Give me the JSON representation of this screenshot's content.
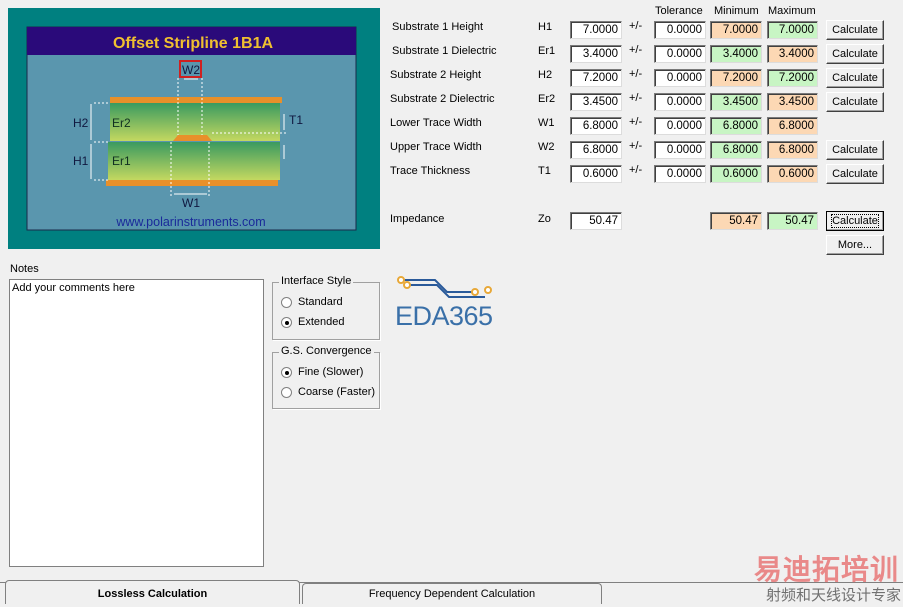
{
  "diagram": {
    "title": "Offset Stripline 1B1A",
    "url": "www.polarinstruments.com",
    "labels": {
      "w2": "W2",
      "w1": "W1",
      "h1": "H1",
      "h2": "H2",
      "er1": "Er1",
      "er2": "Er2",
      "t1": "T1"
    }
  },
  "headers": {
    "tolerance": "Tolerance",
    "minimum": "Minimum",
    "maximum": "Maximum"
  },
  "pm": "+/-",
  "calc_label": "Calculate",
  "rows": [
    {
      "label": "Substrate 1 Height",
      "sym": "H1",
      "value": "7.0000",
      "tol": "0.0000",
      "min": "7.0000",
      "max": "7.0000",
      "calc": true
    },
    {
      "label": "Substrate 1 Dielectric",
      "sym": "Er1",
      "value": "3.4000",
      "tol": "0.0000",
      "min": "3.4000",
      "max": "3.4000",
      "calc": true
    },
    {
      "label": "Substrate 2 Height",
      "sym": "H2",
      "value": "7.2000",
      "tol": "0.0000",
      "min": "7.2000",
      "max": "7.2000",
      "calc": true
    },
    {
      "label": "Substrate 2 Dielectric",
      "sym": "Er2",
      "value": "3.4500",
      "tol": "0.0000",
      "min": "3.4500",
      "max": "3.4500",
      "calc": true
    },
    {
      "label": "Lower Trace Width",
      "sym": "W1",
      "value": "6.8000",
      "tol": "0.0000",
      "min": "6.8000",
      "max": "6.8000",
      "calc": false
    },
    {
      "label": "Upper Trace Width",
      "sym": "W2",
      "value": "6.8000",
      "tol": "0.0000",
      "min": "6.8000",
      "max": "6.8000",
      "calc": true
    },
    {
      "label": "Trace Thickness",
      "sym": "T1",
      "value": "0.6000",
      "tol": "0.0000",
      "min": "0.6000",
      "max": "0.6000",
      "calc": true
    }
  ],
  "impedance": {
    "label": "Impedance",
    "sym": "Zo",
    "value": "50.47",
    "min": "50.47",
    "max": "50.47",
    "calc": "Calculate",
    "more": "More..."
  },
  "notes": {
    "label": "Notes",
    "value": "Add your comments here"
  },
  "interface_style": {
    "title": "Interface Style",
    "options": [
      "Standard",
      "Extended"
    ],
    "selected": 1
  },
  "convergence": {
    "title": "G.S. Convergence",
    "options": [
      "Fine (Slower)",
      "Coarse (Faster)"
    ],
    "selected": 0
  },
  "logo": {
    "text": "EDA365"
  },
  "tabs": [
    "Lossless Calculation",
    "Frequency Dependent Calculation"
  ],
  "watermark": {
    "line1": "易迪拓培训",
    "line2": "射频和天线设计专家"
  },
  "colors": {
    "min_orange": "#fcd8b4",
    "max_green": "#c8f5c4",
    "teal": "#008080",
    "navy": "#2a0a7a"
  }
}
